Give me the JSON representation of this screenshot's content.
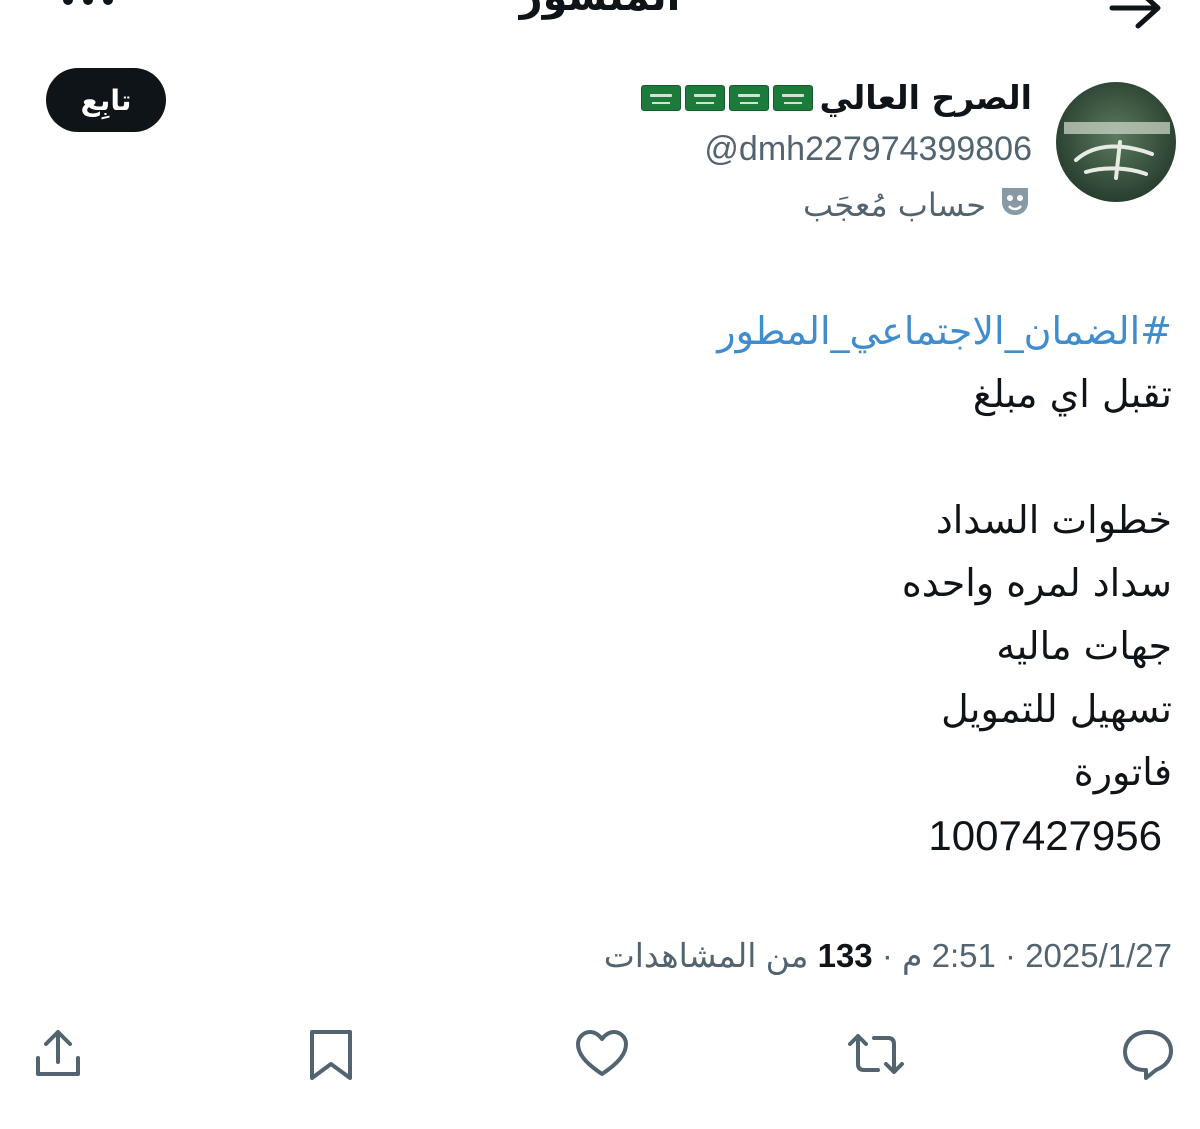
{
  "header": {
    "title": "المنشور"
  },
  "follow_button": {
    "label": "تابِع"
  },
  "author": {
    "display_name": "الصرح العالي",
    "flag_count": 4,
    "handle": "@dmh227974399806",
    "parody_label": "حساب مُعجَب"
  },
  "post": {
    "hashtag": "#الضمان_الاجتماعي_المطور",
    "line1": "تقبل اي مبلغ",
    "line2": "خطوات السداد",
    "line3": "سداد لمره واحده",
    "line4": "جهات ماليه",
    "line5": "تسهيل للتمويل",
    "line6": "فاتورة",
    "number": "1007427956"
  },
  "meta": {
    "date": "2025/1/27",
    "time": "2:51 م",
    "views": "133",
    "views_label": "من المشاهدات",
    "separator": "·"
  },
  "colors": {
    "hashtag": "#3f8dcf",
    "secondary_text": "#536471",
    "primary_text": "#0f1419",
    "follow_bg": "#0f1419"
  }
}
